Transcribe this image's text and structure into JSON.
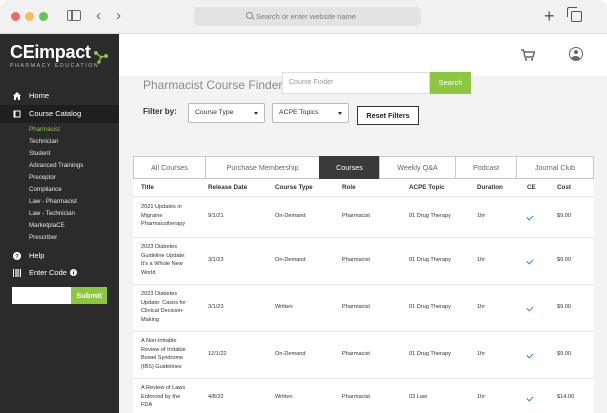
{
  "browser": {
    "address_placeholder": "Search or enter website name",
    "back_glyph": "‹",
    "forward_glyph": "›",
    "new_tab_glyph": "+"
  },
  "sidebar": {
    "logo_text": "CEimpact",
    "logo_subtitle": "PHARMACY EDUCATION",
    "home_label": "Home",
    "catalog_label": "Course Catalog",
    "catalog_items": [
      "Pharmacist",
      "Technician",
      "Student",
      "Advanced Trainings",
      "Preceptor",
      "Compliance",
      "Law - Pharmacist",
      "Law - Technician",
      "MarketplaCE",
      "Prescriber"
    ],
    "help_label": "Help",
    "enter_code_label": "Enter Code",
    "submit_label": "Submit"
  },
  "finder": {
    "title": "Pharmacist Course Finder",
    "input_placeholder": "Course Finder",
    "search_label": "Search",
    "filter_label": "Filter by:",
    "course_type_select": "Course Type",
    "acpe_select": "ACPE Topics",
    "reset_label": "Reset Filters"
  },
  "tabs": [
    "All Courses",
    "Purchase Membership",
    "Courses",
    "Weekly Q&A",
    "Podcast",
    "Journal Club"
  ],
  "active_tab": "Courses",
  "table": {
    "headers": [
      "Title",
      "Release Date",
      "Course Type",
      "Role",
      "ACPE Topic",
      "Duration",
      "CE",
      "Cost"
    ],
    "rows": [
      {
        "title": [
          "2021 Updates in",
          "Migraine",
          "Pharmacotherapy"
        ],
        "date": "9/1/21",
        "type": "On-Demand",
        "role": "Pharmacist",
        "acpe": "01 Drug Therapy",
        "duration": "1hr",
        "ce": true,
        "cost": "$9.00"
      },
      {
        "title": [
          "2023 Diabetes",
          "Guideline Update:",
          "It's a Whole New",
          "World"
        ],
        "date": "3/1/23",
        "type": "On-Demand",
        "role": "Pharmacist",
        "acpe": "01 Drug Therapy",
        "duration": "1hr",
        "ce": true,
        "cost": "$9.00"
      },
      {
        "title": [
          "2023 Diabetes",
          "Update: Cases for",
          "Clinical Decision-",
          "Making"
        ],
        "date": "3/1/23",
        "type": "Written",
        "role": "Pharmacist",
        "acpe": "01 Drug Therapy",
        "duration": "1hr",
        "ce": true,
        "cost": "$9.00"
      },
      {
        "title": [
          "A Non-irritable",
          "Review of Irritable",
          "Bowel Syndrome",
          "(IBS) Guidelines"
        ],
        "date": "12/1/22",
        "type": "On-Demand",
        "role": "Pharmacist",
        "acpe": "01 Drug Therapy",
        "duration": "1hr",
        "ce": true,
        "cost": "$9.00"
      },
      {
        "title": [
          "A Review of Laws",
          "Enforced by the",
          "FDA"
        ],
        "date": "4/8/22",
        "type": "Written",
        "role": "Pharmacist",
        "acpe": "03 Law",
        "duration": "1hr",
        "ce": true,
        "cost": "$14.00"
      }
    ]
  },
  "colors": {
    "accent_green": "#8dc63f",
    "sidebar_bg": "#2b2b2b",
    "check_blue": "#2f7fd1",
    "active_tab_bg": "#3a3a3a"
  }
}
